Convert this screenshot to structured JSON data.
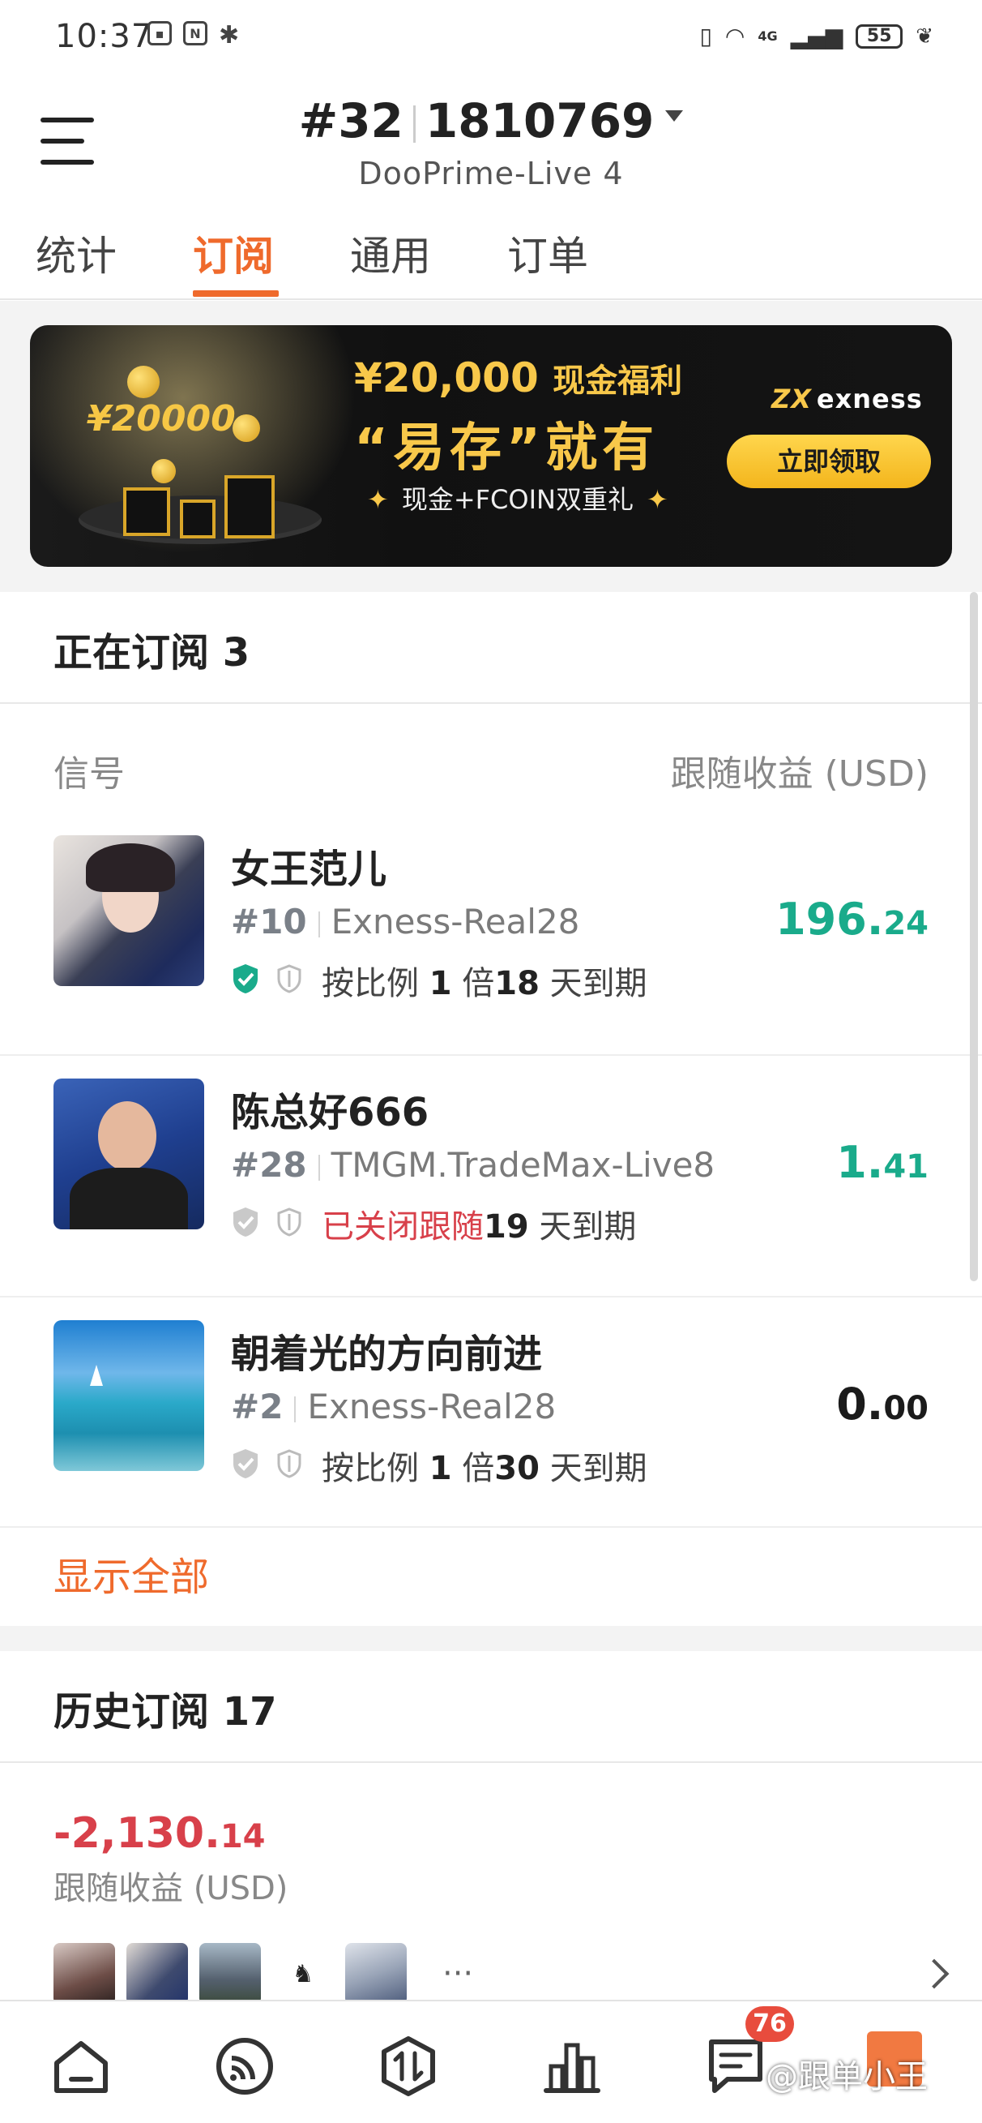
{
  "status_bar": {
    "time": "10:37",
    "battery": "55",
    "network": "4G"
  },
  "header": {
    "account_rank": "#32",
    "account_number": "1810769",
    "server": "DooPrime-Live 4"
  },
  "tabs": [
    {
      "label": "统计",
      "active": false
    },
    {
      "label": "订阅",
      "active": true
    },
    {
      "label": "通用",
      "active": false
    },
    {
      "label": "订单",
      "active": false
    }
  ],
  "banner": {
    "amount_badge": "¥20000",
    "headline_amount": "¥20,000",
    "headline_suffix": "现金福利",
    "slogan": "“易存”就有",
    "subline": "现金+FCOIN双重礼",
    "star": "✦",
    "brand": "exness",
    "brand_mark": "ZX",
    "cta": "立即领取"
  },
  "current": {
    "title": "正在订阅 3",
    "col_signal": "信号",
    "col_profit": "跟随收益 (USD)",
    "show_all": "显示全部",
    "items": [
      {
        "name": "女王范儿",
        "rank": "#10",
        "server": "Exness-Real28",
        "status_prefix": "按比例",
        "multiplier": "1",
        "status_mid": "倍",
        "days": "18",
        "status_suffix": "天到期",
        "profit_int": "196.",
        "profit_dec": "24",
        "verified": true
      },
      {
        "name": "陈总好666",
        "rank": "#28",
        "server": "TMGM.TradeMax-Live8",
        "status_closed": "已关闭跟随",
        "days": "19",
        "status_suffix": "天到期",
        "profit_int": "1.",
        "profit_dec": "41",
        "verified": false
      },
      {
        "name": "朝着光的方向前进",
        "rank": "#2",
        "server": "Exness-Real28",
        "status_prefix": "按比例",
        "multiplier": "1",
        "status_mid": "倍",
        "days": "30",
        "status_suffix": "天到期",
        "profit_int": "0.",
        "profit_dec": "00",
        "verified": false
      }
    ]
  },
  "history": {
    "title": "历史订阅 17",
    "profit_int": "-2,130.",
    "profit_dec": "14",
    "profit_label": "跟随收益 (USD)",
    "more": "···"
  },
  "bottom_nav": {
    "items": [
      "home",
      "signals",
      "trade",
      "stats",
      "messages"
    ],
    "message_badge": "76"
  },
  "watermark": "@跟单小王",
  "colors": {
    "accent": "#ef6a2c",
    "profit_positive": "#1aab8b",
    "profit_negative": "#d8404a",
    "verified": "#1aab8b"
  }
}
